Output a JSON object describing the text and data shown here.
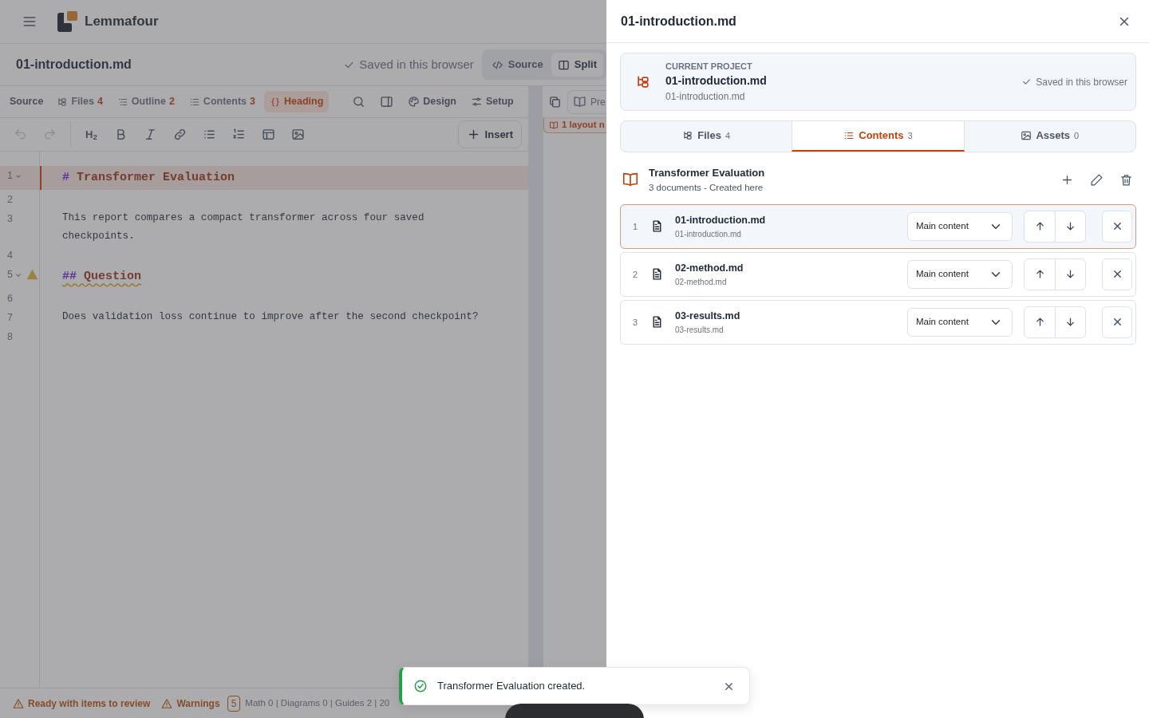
{
  "app": {
    "brand": "Lemmafour"
  },
  "document": {
    "title": "01-introduction.md",
    "save_status": "Saved in this browser",
    "view_modes": [
      {
        "kind": "source",
        "label": "Source",
        "selected": false
      },
      {
        "kind": "split",
        "label": "Split",
        "selected": true
      }
    ]
  },
  "panel_bar": {
    "label": "Source",
    "tabs": [
      {
        "kind": "files",
        "label": "Files",
        "count": "4",
        "selected": false
      },
      {
        "kind": "outline",
        "label": "Outline",
        "count": "2",
        "selected": false
      },
      {
        "kind": "contents",
        "label": "Contents",
        "count": "3",
        "selected": false
      },
      {
        "kind": "heading",
        "label": "Heading",
        "selected": true
      }
    ],
    "tools": [
      {
        "kind": "design",
        "label": "Design"
      },
      {
        "kind": "setup",
        "label": "Setup"
      }
    ]
  },
  "format_toolbar": {
    "undo_disabled": true,
    "redo_disabled": true,
    "heading_label": "H$_{2}$",
    "insert_label": "Insert"
  },
  "editor": {
    "lines": [
      {
        "number": "1",
        "kind": "heading",
        "marker": "#",
        "text": "Transformer Evaluation",
        "foldable": true,
        "active": true,
        "warning": false
      },
      {
        "number": "2",
        "kind": "blank",
        "foldable": false,
        "active": false,
        "warning": false
      },
      {
        "number": "3",
        "kind": "text",
        "text": "This report compares a compact transformer across four saved checkpoints.",
        "foldable": false,
        "active": false,
        "warning": false
      },
      {
        "number": "4",
        "kind": "blank",
        "foldable": false,
        "active": false,
        "warning": false
      },
      {
        "number": "5",
        "kind": "heading",
        "marker": "##",
        "text": "Question",
        "foldable": true,
        "active": false,
        "warning": true
      },
      {
        "number": "6",
        "kind": "blank",
        "foldable": false,
        "active": false,
        "warning": false
      },
      {
        "number": "7",
        "kind": "text",
        "text": "Does validation loss continue to improve after the second checkpoint?",
        "foldable": false,
        "active": false,
        "warning": false
      },
      {
        "number": "8",
        "kind": "blank",
        "foldable": false,
        "active": false,
        "warning": false
      }
    ]
  },
  "preview": {
    "button_label": "Pre",
    "warning_badge": "1 layout n"
  },
  "status_bar": {
    "state": "Ready with items to review",
    "warnings_label": "Warnings",
    "warnings_count": "5",
    "stats": "Math 0 | Diagrams 0 | Guides 2 | 20"
  },
  "drawer": {
    "title": "01-introduction.md",
    "project": {
      "caption": "CURRENT PROJECT",
      "name": "01-introduction.md",
      "path": "01-introduction.md",
      "save_status": "Saved in this browser"
    },
    "tabs": [
      {
        "kind": "files",
        "label": "Files",
        "count": "4",
        "selected": false
      },
      {
        "kind": "contents",
        "label": "Contents",
        "count": "3",
        "selected": true
      },
      {
        "kind": "assets",
        "label": "Assets",
        "count": "0",
        "selected": false
      }
    ],
    "collection": {
      "title": "Transformer Evaluation",
      "meta": "3 documents - Created here",
      "items": [
        {
          "index": "1",
          "title": "01-introduction.md",
          "path": "01-introduction.md",
          "role": "Main content",
          "selected": true
        },
        {
          "index": "2",
          "title": "02-method.md",
          "path": "02-method.md",
          "role": "Main content",
          "selected": false
        },
        {
          "index": "3",
          "title": "03-results.md",
          "path": "03-results.md",
          "role": "Main content",
          "selected": false
        }
      ]
    }
  },
  "toast": {
    "message": "Transformer Evaluation created."
  }
}
